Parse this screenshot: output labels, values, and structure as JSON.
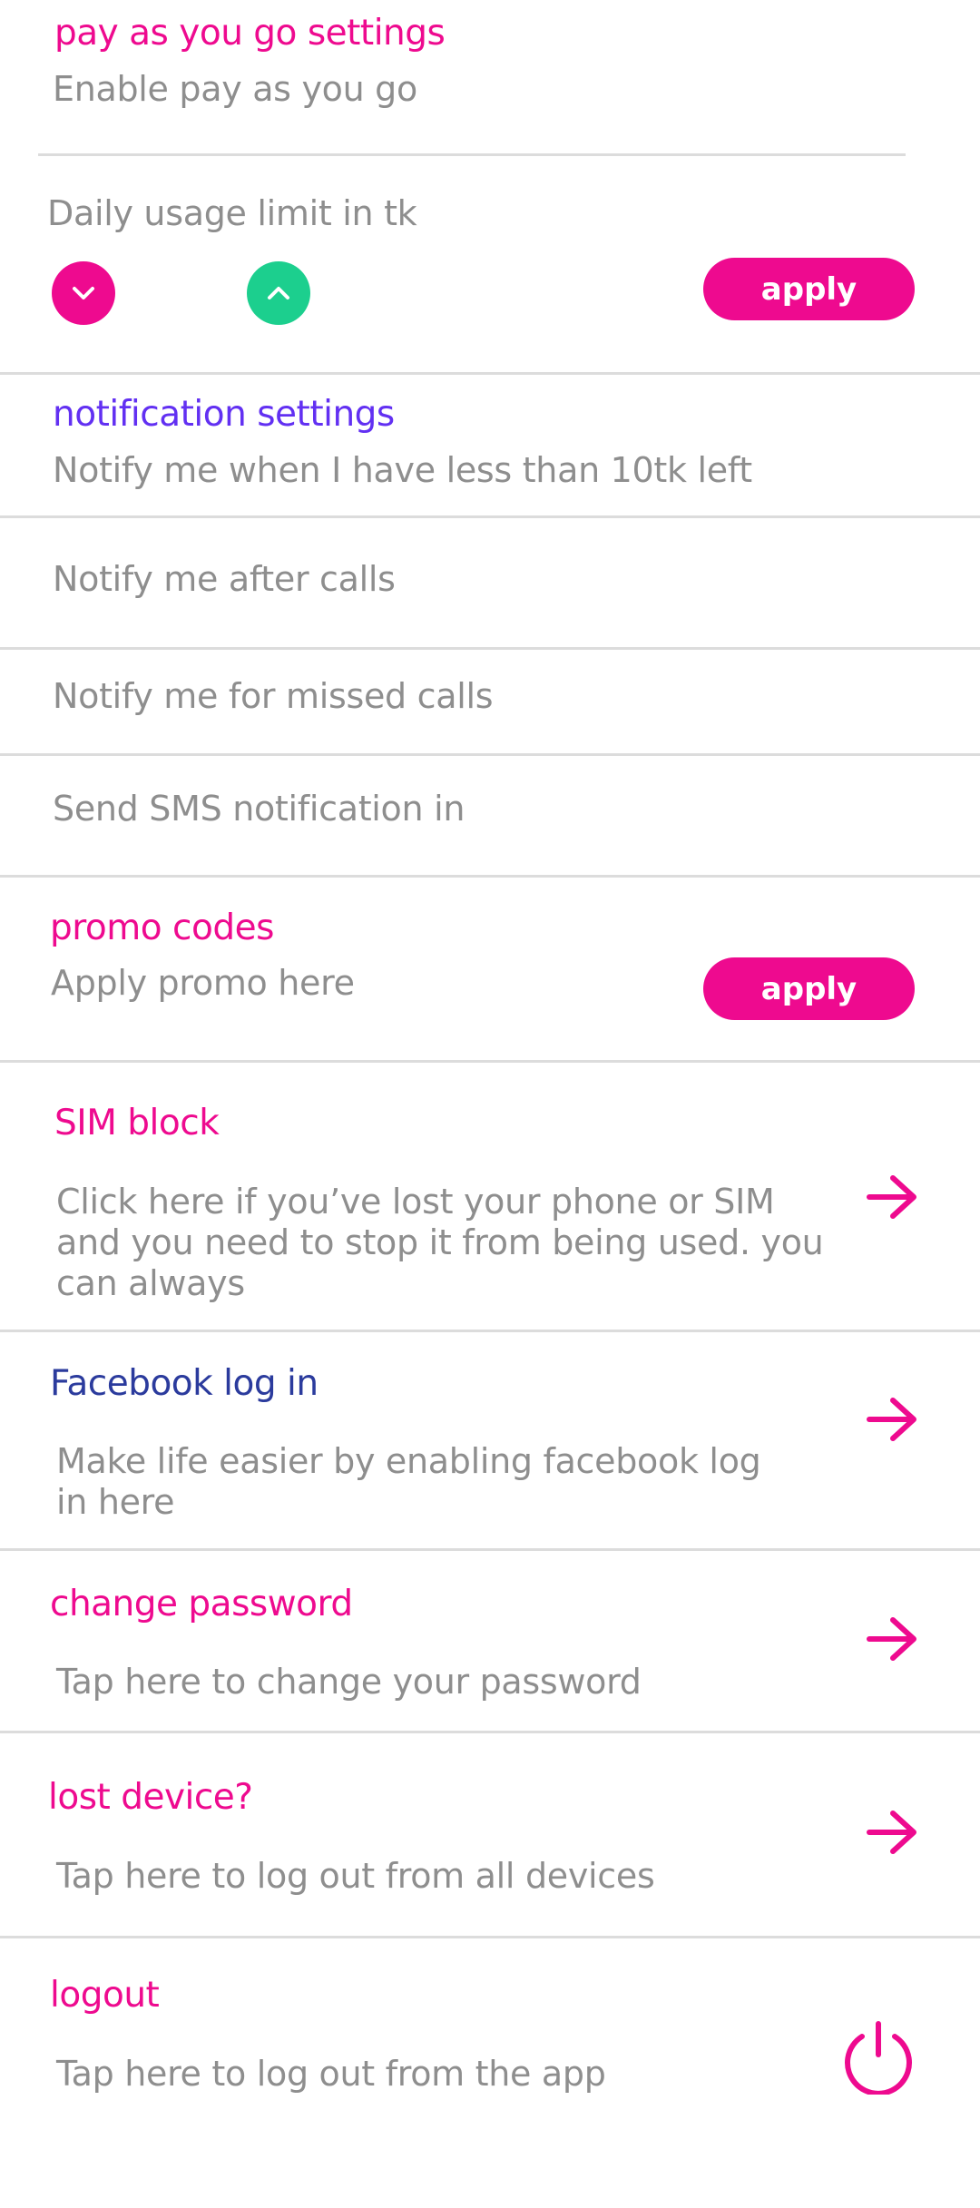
{
  "payg": {
    "heading": "pay as you go settings",
    "enable_label": "Enable pay as you go",
    "limit_label": "Daily usage limit in tk",
    "apply_label": "apply"
  },
  "notifications": {
    "heading": "notification settings",
    "low_balance": "Notify me when I have less than 10tk left",
    "after_calls": "Notify me after calls",
    "missed_calls": "Notify me for missed calls",
    "sms": "Send SMS notification in"
  },
  "promo": {
    "heading": "promo codes",
    "placeholder": "Apply promo here",
    "apply_label": "apply"
  },
  "sim_block": {
    "heading": "SIM block",
    "description": "Click here if you’ve lost your phone or SIM and you need to stop it from being used. you can always"
  },
  "facebook": {
    "heading": "Facebook log in",
    "description": "Make life easier by enabling facebook log in here"
  },
  "change_password": {
    "heading": "change password",
    "description": "Tap here to change your password"
  },
  "lost_device": {
    "heading": "lost device?",
    "description": "Tap here to log out from all devices"
  },
  "logout": {
    "heading": "logout",
    "description": "Tap here to log out from the app"
  },
  "icons": {
    "decrease": "chevron-down-icon",
    "increase": "chevron-up-icon",
    "arrow": "arrow-right-icon",
    "power": "power-icon"
  },
  "colors": {
    "accent_pink": "#ee0a8f",
    "accent_green": "#1ccf8e",
    "notification_purple": "#6230f2",
    "facebook_navy": "#2b3b9d",
    "muted_text": "#8e8e8e",
    "divider": "#dcdcdc"
  }
}
